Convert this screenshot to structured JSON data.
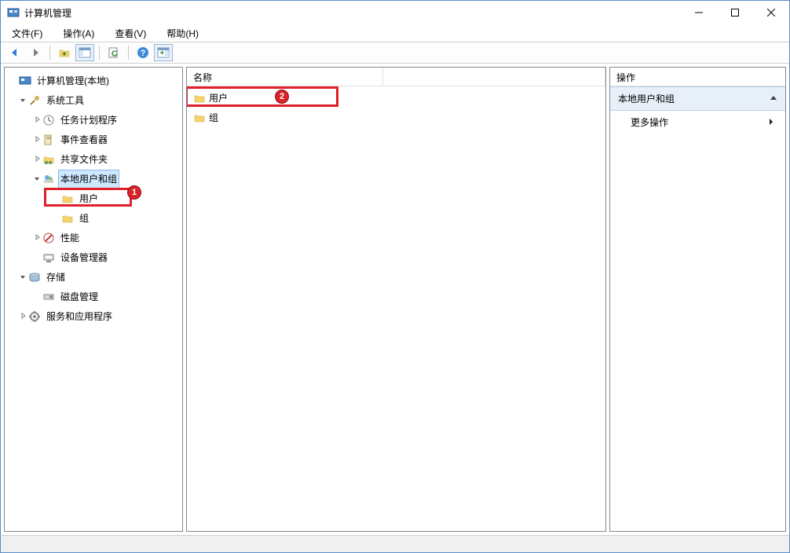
{
  "window": {
    "title": "计算机管理"
  },
  "menu": {
    "file": "文件(F)",
    "action": "操作(A)",
    "view": "查看(V)",
    "help": "帮助(H)"
  },
  "tree": {
    "root": "计算机管理(本地)",
    "system_tools": "系统工具",
    "task_scheduler": "任务计划程序",
    "event_viewer": "事件查看器",
    "shared_folders": "共享文件夹",
    "local_users_groups": "本地用户和组",
    "users": "用户",
    "groups": "组",
    "performance": "性能",
    "device_manager": "设备管理器",
    "storage": "存储",
    "disk_management": "磁盘管理",
    "services_apps": "服务和应用程序"
  },
  "list": {
    "header_name": "名称",
    "items": {
      "users": "用户",
      "groups": "组"
    }
  },
  "actions": {
    "header": "操作",
    "section": "本地用户和组",
    "more": "更多操作"
  },
  "annotations": {
    "badge1": "1",
    "badge2": "2"
  }
}
